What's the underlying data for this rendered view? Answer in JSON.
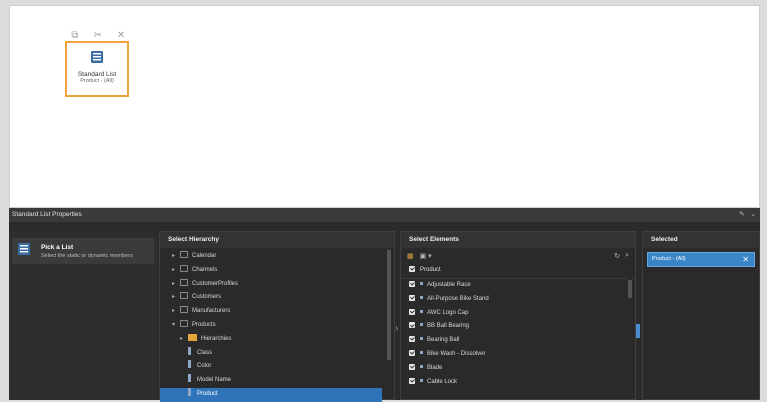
{
  "canvas": {
    "toolbar": {
      "copy_icon": "copy-icon",
      "cut_icon": "scissors-icon",
      "close_icon": "close-icon"
    },
    "widget": {
      "title": "Standard List",
      "subtitle": "Product - (All)"
    }
  },
  "properties": {
    "title": "Standard List Properties",
    "pick": {
      "title": "Pick a List",
      "subtitle": "Select the static or dynamic members"
    },
    "hierarchy": {
      "header": "Select Hierarchy",
      "items": [
        {
          "label": "Calendar",
          "expanded": false
        },
        {
          "label": "Channels",
          "expanded": false
        },
        {
          "label": "CustomerProfiles",
          "expanded": false
        },
        {
          "label": "Customers",
          "expanded": false
        },
        {
          "label": "Manufacturers",
          "expanded": false
        },
        {
          "label": "Products",
          "expanded": true
        }
      ],
      "folder": "Hierarchies",
      "levels": [
        "Class",
        "Color",
        "Model Name",
        "Product"
      ],
      "selected": "Product"
    },
    "elements": {
      "header": "Select Elements",
      "product_label": "Product",
      "items": [
        "Adjustable Race",
        "All-Purpose Bike Stand",
        "AWC Logo Cap",
        "BB Ball Bearing",
        "Bearing Ball",
        "Bike Wash - Dissolver",
        "Blade",
        "Cable Lock"
      ]
    },
    "selected": {
      "header": "Selected",
      "chip": "Product - (All)"
    }
  },
  "colors": {
    "accent_orange": "#f0a23b",
    "selection_blue": "#2f74b8",
    "panel_dark": "#2b2b2b"
  }
}
